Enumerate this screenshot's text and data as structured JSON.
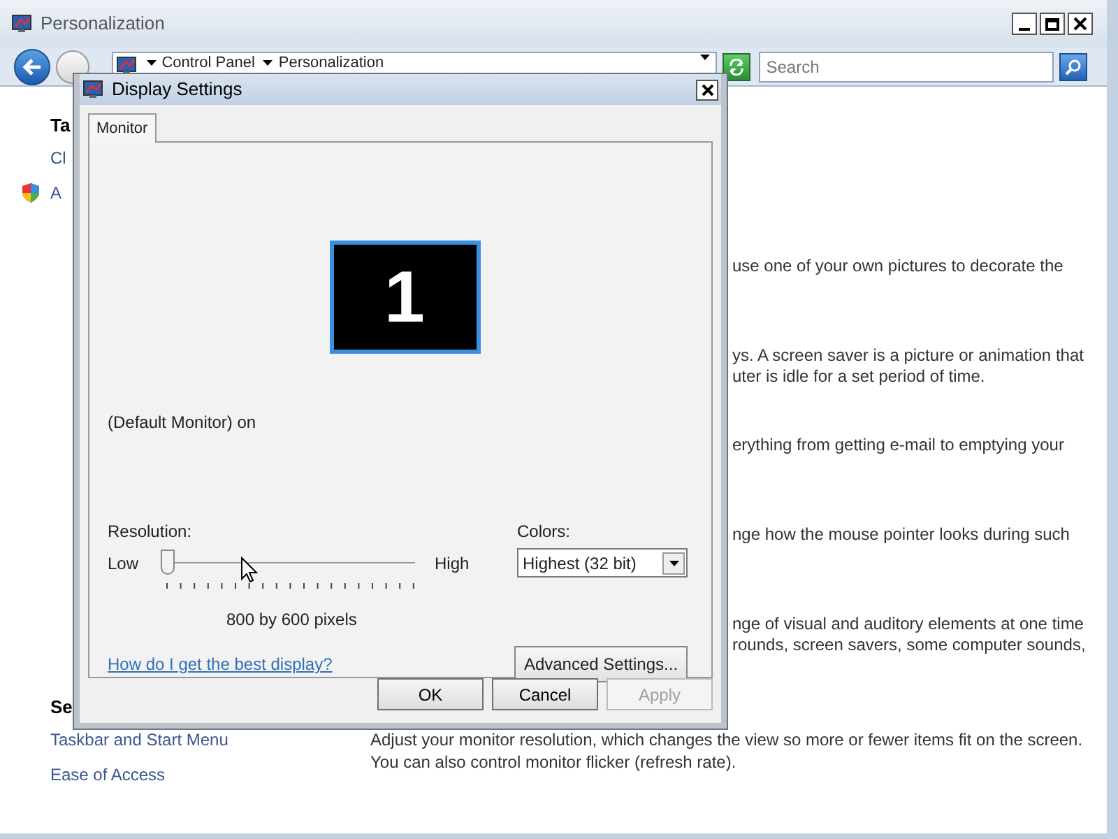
{
  "window": {
    "title": "Personalization"
  },
  "address_bar": {
    "breadcrumbs": [
      "Control Panel",
      "Personalization"
    ],
    "search": {
      "placeholder": "Search"
    }
  },
  "sidebar": {
    "heading_1": "Ta",
    "items_1": [
      {
        "label": "Cl",
        "kind": "link"
      },
      {
        "label": "A",
        "kind": "shield-link"
      }
    ],
    "heading_2": "Se",
    "items_2": [
      {
        "label": "Taskbar and Start Menu",
        "kind": "link"
      },
      {
        "label": "Ease of Access",
        "kind": "link"
      }
    ]
  },
  "content": {
    "paragraphs": [
      [
        "use one of your own pictures to decorate the"
      ],
      [
        "ys. A screen saver is a picture or animation that",
        "uter is idle for a set period of time."
      ],
      [
        "erything from getting e-mail to emptying your"
      ],
      [
        "nge how the mouse pointer looks during such"
      ],
      [
        "nge of visual and auditory elements at one time",
        "rounds, screen savers, some computer sounds,"
      ]
    ],
    "footer": [
      "Adjust your monitor resolution, which changes the view so more or fewer items fit on the screen.",
      "You can also control monitor flicker (refresh rate)."
    ]
  },
  "dialog": {
    "title": "Display Settings",
    "tabs": [
      {
        "label": "Monitor",
        "selected": true
      }
    ],
    "monitor_number": "1",
    "monitor_name": "(Default Monitor) on",
    "resolution": {
      "label": "Resolution:",
      "low": "Low",
      "high": "High",
      "level": 0,
      "reading": "800 by 600 pixels"
    },
    "colors": {
      "label": "Colors:",
      "value": "Highest (32 bit)"
    },
    "help_link": "How do I get the best display?",
    "advanced_button": "Advanced Settings...",
    "buttons": [
      {
        "label": "OK",
        "disabled": false
      },
      {
        "label": "Cancel",
        "disabled": false
      },
      {
        "label": "Apply",
        "disabled": true
      }
    ]
  }
}
